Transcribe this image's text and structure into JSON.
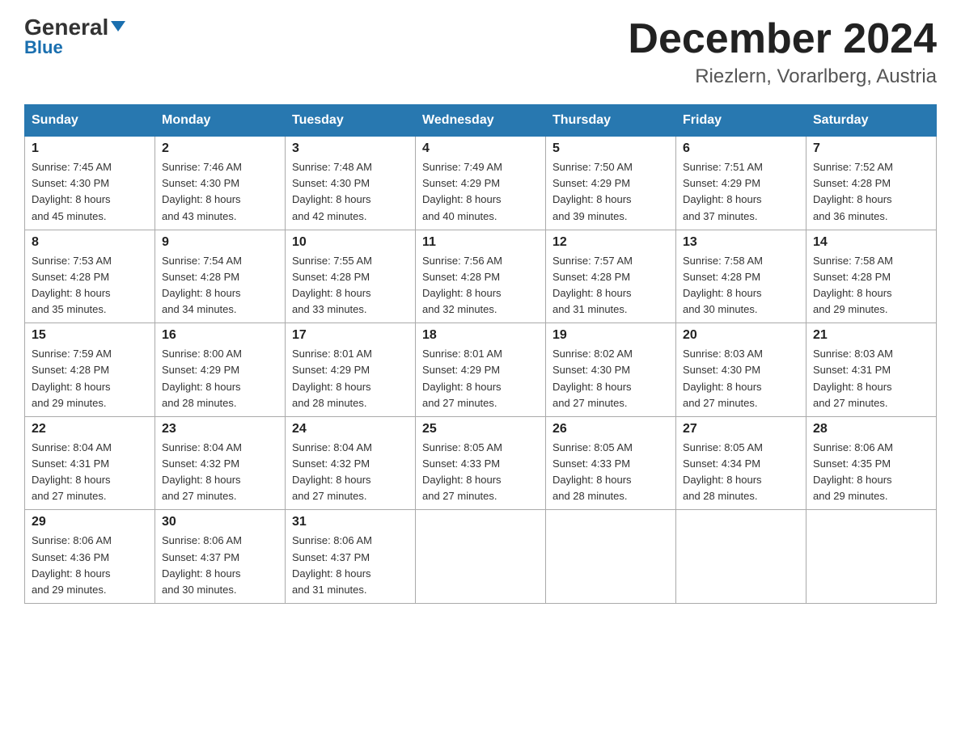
{
  "header": {
    "logo_main": "General",
    "logo_sub": "Blue",
    "month_title": "December 2024",
    "location": "Riezlern, Vorarlberg, Austria"
  },
  "days_of_week": [
    "Sunday",
    "Monday",
    "Tuesday",
    "Wednesday",
    "Thursday",
    "Friday",
    "Saturday"
  ],
  "weeks": [
    [
      {
        "num": "1",
        "sunrise": "7:45 AM",
        "sunset": "4:30 PM",
        "daylight": "8 hours and 45 minutes."
      },
      {
        "num": "2",
        "sunrise": "7:46 AM",
        "sunset": "4:30 PM",
        "daylight": "8 hours and 43 minutes."
      },
      {
        "num": "3",
        "sunrise": "7:48 AM",
        "sunset": "4:30 PM",
        "daylight": "8 hours and 42 minutes."
      },
      {
        "num": "4",
        "sunrise": "7:49 AM",
        "sunset": "4:29 PM",
        "daylight": "8 hours and 40 minutes."
      },
      {
        "num": "5",
        "sunrise": "7:50 AM",
        "sunset": "4:29 PM",
        "daylight": "8 hours and 39 minutes."
      },
      {
        "num": "6",
        "sunrise": "7:51 AM",
        "sunset": "4:29 PM",
        "daylight": "8 hours and 37 minutes."
      },
      {
        "num": "7",
        "sunrise": "7:52 AM",
        "sunset": "4:28 PM",
        "daylight": "8 hours and 36 minutes."
      }
    ],
    [
      {
        "num": "8",
        "sunrise": "7:53 AM",
        "sunset": "4:28 PM",
        "daylight": "8 hours and 35 minutes."
      },
      {
        "num": "9",
        "sunrise": "7:54 AM",
        "sunset": "4:28 PM",
        "daylight": "8 hours and 34 minutes."
      },
      {
        "num": "10",
        "sunrise": "7:55 AM",
        "sunset": "4:28 PM",
        "daylight": "8 hours and 33 minutes."
      },
      {
        "num": "11",
        "sunrise": "7:56 AM",
        "sunset": "4:28 PM",
        "daylight": "8 hours and 32 minutes."
      },
      {
        "num": "12",
        "sunrise": "7:57 AM",
        "sunset": "4:28 PM",
        "daylight": "8 hours and 31 minutes."
      },
      {
        "num": "13",
        "sunrise": "7:58 AM",
        "sunset": "4:28 PM",
        "daylight": "8 hours and 30 minutes."
      },
      {
        "num": "14",
        "sunrise": "7:58 AM",
        "sunset": "4:28 PM",
        "daylight": "8 hours and 29 minutes."
      }
    ],
    [
      {
        "num": "15",
        "sunrise": "7:59 AM",
        "sunset": "4:28 PM",
        "daylight": "8 hours and 29 minutes."
      },
      {
        "num": "16",
        "sunrise": "8:00 AM",
        "sunset": "4:29 PM",
        "daylight": "8 hours and 28 minutes."
      },
      {
        "num": "17",
        "sunrise": "8:01 AM",
        "sunset": "4:29 PM",
        "daylight": "8 hours and 28 minutes."
      },
      {
        "num": "18",
        "sunrise": "8:01 AM",
        "sunset": "4:29 PM",
        "daylight": "8 hours and 27 minutes."
      },
      {
        "num": "19",
        "sunrise": "8:02 AM",
        "sunset": "4:30 PM",
        "daylight": "8 hours and 27 minutes."
      },
      {
        "num": "20",
        "sunrise": "8:03 AM",
        "sunset": "4:30 PM",
        "daylight": "8 hours and 27 minutes."
      },
      {
        "num": "21",
        "sunrise": "8:03 AM",
        "sunset": "4:31 PM",
        "daylight": "8 hours and 27 minutes."
      }
    ],
    [
      {
        "num": "22",
        "sunrise": "8:04 AM",
        "sunset": "4:31 PM",
        "daylight": "8 hours and 27 minutes."
      },
      {
        "num": "23",
        "sunrise": "8:04 AM",
        "sunset": "4:32 PM",
        "daylight": "8 hours and 27 minutes."
      },
      {
        "num": "24",
        "sunrise": "8:04 AM",
        "sunset": "4:32 PM",
        "daylight": "8 hours and 27 minutes."
      },
      {
        "num": "25",
        "sunrise": "8:05 AM",
        "sunset": "4:33 PM",
        "daylight": "8 hours and 27 minutes."
      },
      {
        "num": "26",
        "sunrise": "8:05 AM",
        "sunset": "4:33 PM",
        "daylight": "8 hours and 28 minutes."
      },
      {
        "num": "27",
        "sunrise": "8:05 AM",
        "sunset": "4:34 PM",
        "daylight": "8 hours and 28 minutes."
      },
      {
        "num": "28",
        "sunrise": "8:06 AM",
        "sunset": "4:35 PM",
        "daylight": "8 hours and 29 minutes."
      }
    ],
    [
      {
        "num": "29",
        "sunrise": "8:06 AM",
        "sunset": "4:36 PM",
        "daylight": "8 hours and 29 minutes."
      },
      {
        "num": "30",
        "sunrise": "8:06 AM",
        "sunset": "4:37 PM",
        "daylight": "8 hours and 30 minutes."
      },
      {
        "num": "31",
        "sunrise": "8:06 AM",
        "sunset": "4:37 PM",
        "daylight": "8 hours and 31 minutes."
      },
      null,
      null,
      null,
      null
    ]
  ]
}
